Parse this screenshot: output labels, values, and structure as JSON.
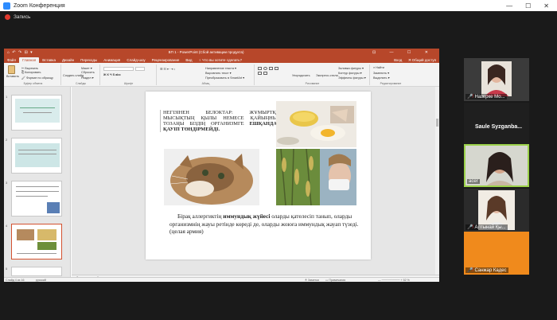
{
  "app": {
    "title": "Zoom Конференция",
    "record_label": "Запись",
    "ctrl_min": "—",
    "ctrl_max": "☐",
    "ctrl_close": "✕"
  },
  "ppt": {
    "title": "ВП 1 - PowerPoint (Сбой активации продукта)",
    "quick_access": "⌂ ↶ ↷ ⊟ ▾",
    "window_ctrls": "⊡ — ☐ ✕",
    "tabs": [
      "Файл",
      "Главная",
      "Вставка",
      "Дизайн",
      "Переходы",
      "Анимация",
      "Слайд-шоу",
      "Рецензирование",
      "Вид",
      "♀ Что вы хотите сделать?"
    ],
    "tabs_right": [
      "Вход",
      "Я Общий доступ"
    ],
    "ribbon": {
      "paste": "Вставить",
      "cut": "✂ Вырезать",
      "copy": "⎘ Копировать",
      "format_painter": "🖌 Формат по образцу",
      "clipboard_group": "Буфер обмена",
      "new_slide": "Создать слайд",
      "layout": "Макет ▾",
      "reset": "Сбросить",
      "section": "Раздел ▾",
      "slides_group": "Слайды",
      "font_group": "Шрифт",
      "paragraph_group": "Абзац",
      "text_direction": "Направление текста ▾",
      "align_text": "Выровнять текст ▾",
      "smartart": "Преобразовать в SmartArt ▾",
      "arrange": "Упорядочить",
      "quick_styles": "Экспресс-стили",
      "fill": "Заливка фигуры ▾",
      "outline": "Контур фигуры ▾",
      "effects": "Эффекты фигуры ▾",
      "drawing_group": "Рисование",
      "find": "⌕ Найти",
      "replace": "Заменить ▾",
      "select": "Выделить ▾",
      "editing_group": "Редактирование"
    },
    "thumbs": [
      "1",
      "2",
      "3",
      "4",
      "5"
    ],
    "slide_text_1": "НЕГІЗІНЕН БЕЛОКТАР: ЖҰМЫРТҚА, МЫСЫҚТЫҢ ҚЫЛЫ НЕМЕСЕ ҚАЙЫҢНЫҢ ТОЗАҢЫ БІЗДІҢ ОРГАНИЗМГЕ ",
    "slide_text_1_bold": "ЕШҚАНДАЙ ҚАУІП ТӨНДІРМЕЙДІ.",
    "slide_text_2_a": "Бірақ аллергиктің ",
    "slide_text_2_bold": "иммундық жүйесі",
    "slide_text_2_b": " оларды қателесіп танып, оларды организмнің жауы ретінде көреді де, оларды жоюға иммундық жауап түзеді. (целая армия)",
    "notes": "Заметки к слайду",
    "status_left": "Слайд 4 из 16",
    "status_lang": "русский",
    "status_notes": "≜ Заметки",
    "status_comments": "▭ Примечания",
    "status_zoom": "— ───────── + 52 %"
  },
  "participants": [
    {
      "name": "Назерке Мо...",
      "muted": true
    },
    {
      "name": "Saule Syzganba...",
      "muted": false
    },
    {
      "name": "acer",
      "muted": false
    },
    {
      "name": "Алтынай Қы...",
      "muted": true
    },
    {
      "name": "Санжар Кадес",
      "muted": true
    }
  ],
  "colors": {
    "accent_ppt": "#b7472a",
    "zoom_blue": "#2d8cff",
    "active_speaker": "#9bd14a",
    "tile_orange": "#f08a1c"
  }
}
